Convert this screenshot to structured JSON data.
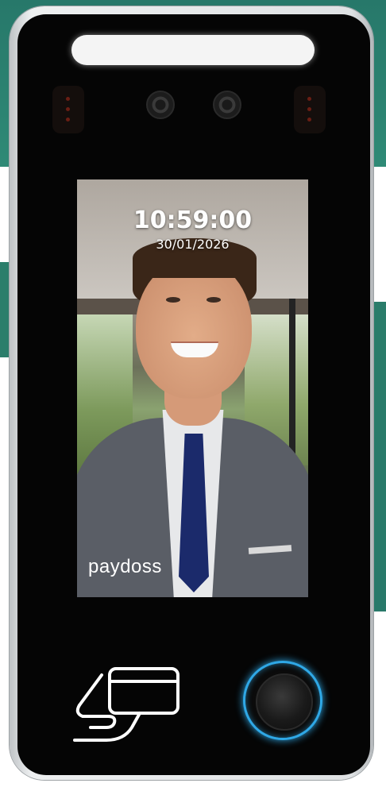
{
  "screen": {
    "time": "10:59:00",
    "date": "30/01/2026",
    "brand": "paydoss"
  },
  "device": {
    "accent_ring_color": "#2fa8e6",
    "icons": [
      "camera-icon",
      "camera-icon",
      "card-tap-icon",
      "fingerprint-sensor-icon"
    ]
  }
}
